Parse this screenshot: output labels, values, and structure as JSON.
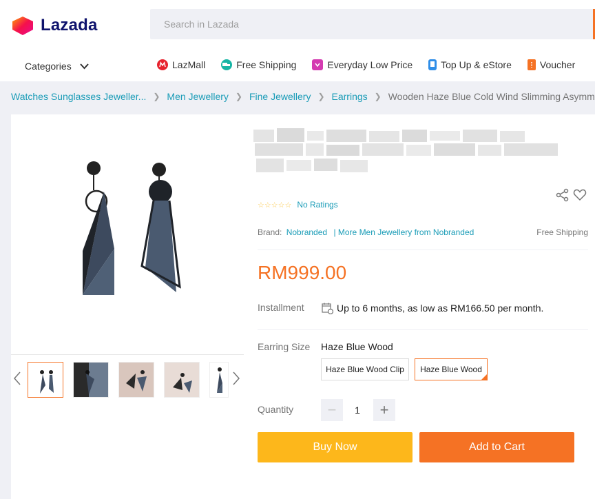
{
  "header": {
    "logo_text": "Lazada",
    "search_placeholder": "Search in Lazada",
    "categories_label": "Categories",
    "nav": [
      {
        "label": "LazMall",
        "icon": "lazmall-icon",
        "color": "#e7232e"
      },
      {
        "label": "Free Shipping",
        "icon": "free-shipping-icon",
        "color": "#17b5a5"
      },
      {
        "label": "Everyday Low Price",
        "icon": "low-price-icon",
        "color": "#d43bb1"
      },
      {
        "label": "Top Up & eStore",
        "icon": "top-up-icon",
        "color": "#2f8ee8"
      },
      {
        "label": "Voucher",
        "icon": "voucher-icon",
        "color": "#f57224"
      }
    ]
  },
  "breadcrumb": [
    "Watches Sunglasses Jeweller...",
    "Men Jewellery",
    "Fine Jewellery",
    "Earrings"
  ],
  "breadcrumb_current": "Wooden Haze Blue Cold Wind Slimming Asymmetric",
  "product": {
    "rating_stars": "☆☆☆☆☆",
    "ratings_text": "No Ratings",
    "brand_label": "Brand:",
    "brand_name": "Nobranded",
    "brand_more": "| More Men Jewellery from Nobranded",
    "free_shipping": "Free Shipping",
    "price": "RM999.00",
    "installment_label": "Installment",
    "installment_text": "Up to 6 months, as low as RM166.50 per month.",
    "size_label": "Earring Size",
    "size_selected": "Haze Blue Wood",
    "size_options": [
      "Haze Blue Wood Clip",
      "Haze Blue Wood"
    ],
    "quantity_label": "Quantity",
    "quantity": "1",
    "minus": "−",
    "plus": "+",
    "buy_now": "Buy Now",
    "add_to_cart": "Add to Cart"
  },
  "colors": {
    "accent": "#f57224",
    "buy_now": "#fdb71b",
    "add_to_cart": "#f57224",
    "link": "#1a9cb7",
    "logo_text": "#0f136d"
  }
}
